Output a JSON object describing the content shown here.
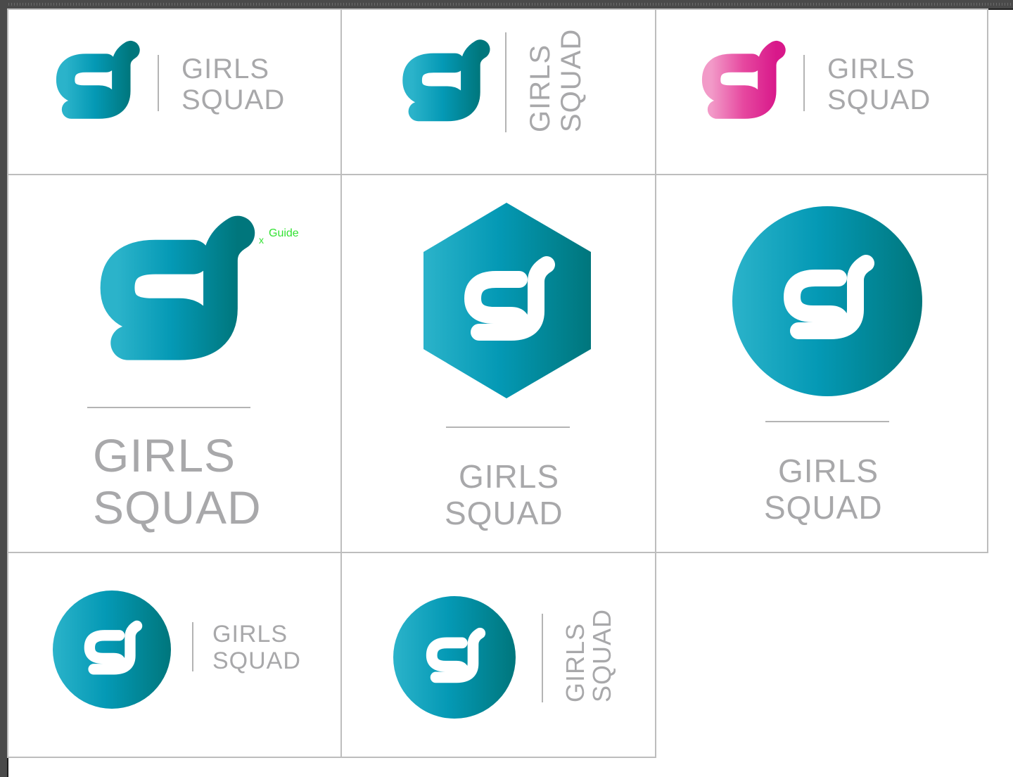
{
  "brand": {
    "line1": "GIRLS",
    "line2": "SQUAD"
  },
  "guide": {
    "label": "Guide",
    "marker": "x"
  },
  "colors": {
    "teal_light": "#2bb3ca",
    "teal_mid": "#0499b5",
    "teal_dark": "#00767c",
    "pink_light": "#f29ac8",
    "pink_dark": "#de1a8c",
    "wordmark_gray": "#a8a8aa",
    "divider_gray": "#b4b4b4",
    "cell_border": "#bdbdbd",
    "guide_green": "#33e233"
  },
  "icons": [
    "sg-monogram-icon",
    "hexagon-badge-icon",
    "circle-badge-icon"
  ]
}
